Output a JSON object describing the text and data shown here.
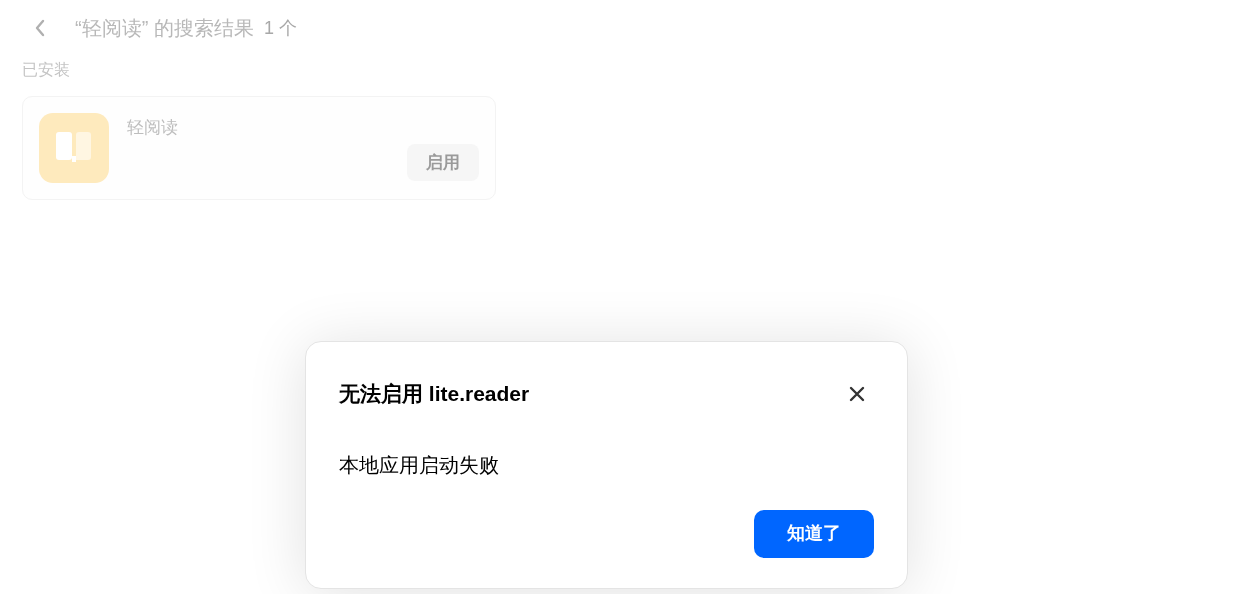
{
  "header": {
    "title": "“轻阅读” 的搜索结果",
    "count": "1 个"
  },
  "section": {
    "label": "已安装"
  },
  "apps": [
    {
      "name": "轻阅读",
      "action": "启用"
    }
  ],
  "dialog": {
    "title": "无法启用 lite.reader",
    "message": "本地应用启动失败",
    "button": "知道了"
  }
}
